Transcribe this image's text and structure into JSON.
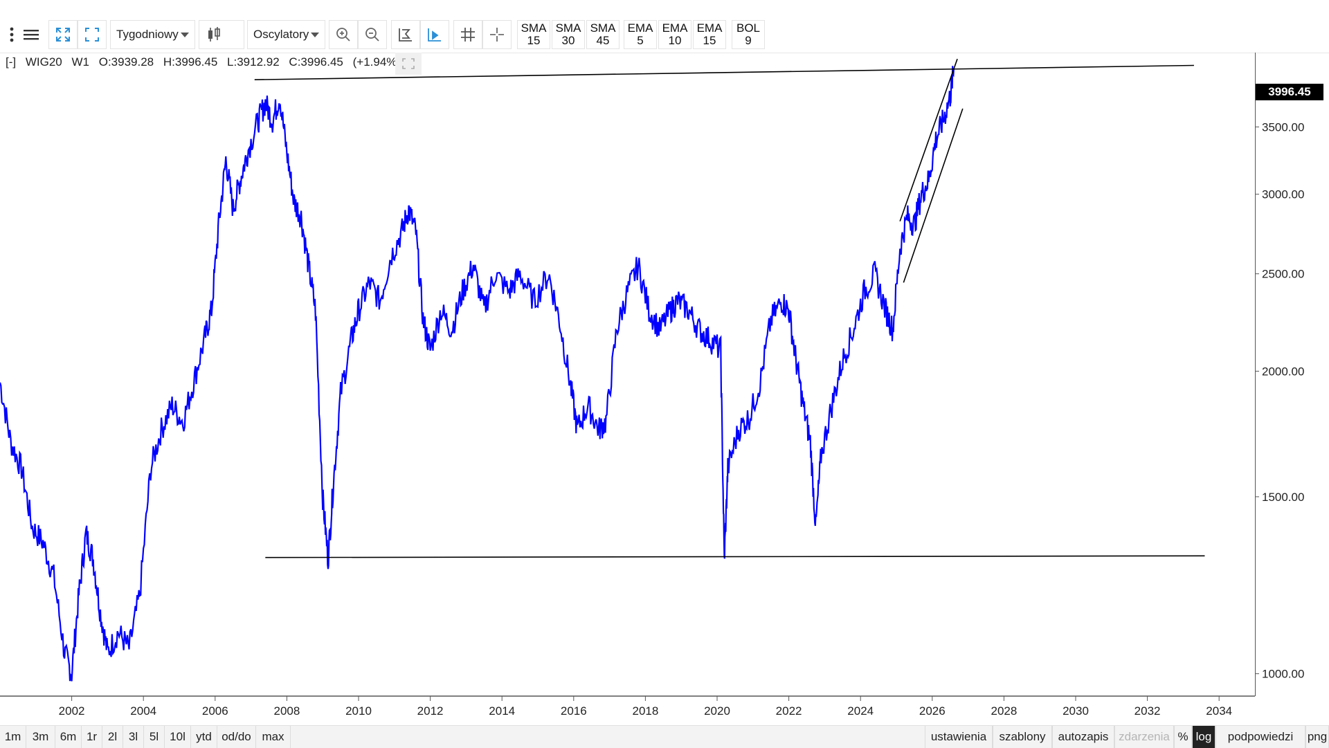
{
  "toolbar": {
    "period_label": "Tygodniowy",
    "oscillators_label": "Oscylatory",
    "indicators": [
      {
        "name": "SMA",
        "value": "15"
      },
      {
        "name": "SMA",
        "value": "30"
      },
      {
        "name": "SMA",
        "value": "45"
      },
      {
        "name": "EMA",
        "value": "5"
      },
      {
        "name": "EMA",
        "value": "10"
      },
      {
        "name": "EMA",
        "value": "15"
      },
      {
        "name": "BOL",
        "value": "9"
      }
    ]
  },
  "info": {
    "collapse": "[-]",
    "symbol": "WIG20",
    "interval": "W1",
    "open": "O:3939.28",
    "high": "H:3996.45",
    "low": "L:3912.92",
    "close": "C:3996.45",
    "change": "(+1.94%)"
  },
  "last_price_label": "3996.45",
  "colors": {
    "series": "#0000ff",
    "trendline": "#000000",
    "axis": "#555555"
  },
  "chart_data": {
    "type": "line",
    "scale": "log",
    "grid": false,
    "x_ticks": [
      "2002",
      "2004",
      "2006",
      "2008",
      "2010",
      "2012",
      "2014",
      "2016",
      "2018",
      "2020",
      "2022",
      "2024",
      "2026",
      "2028",
      "2030",
      "2032",
      "2034"
    ],
    "y_ticks": [
      1000,
      1500,
      2000,
      2500,
      3000,
      3500
    ],
    "y_tick_labels": [
      "1000.00",
      "1500.00",
      "2000.00",
      "2500.00",
      "3000.00",
      "3500.00"
    ],
    "xlim": [
      2000.0,
      2035.0
    ],
    "ylim": [
      950,
      4150
    ],
    "series_points": [
      [
        2000.0,
        1950
      ],
      [
        2000.3,
        1700
      ],
      [
        2000.6,
        1600
      ],
      [
        2000.9,
        1400
      ],
      [
        2001.2,
        1350
      ],
      [
        2001.5,
        1250
      ],
      [
        2001.8,
        1050
      ],
      [
        2002.0,
        1000
      ],
      [
        2002.2,
        1200
      ],
      [
        2002.4,
        1380
      ],
      [
        2002.6,
        1300
      ],
      [
        2002.8,
        1150
      ],
      [
        2003.0,
        1050
      ],
      [
        2003.3,
        1100
      ],
      [
        2003.6,
        1060
      ],
      [
        2003.9,
        1200
      ],
      [
        2004.2,
        1600
      ],
      [
        2004.5,
        1750
      ],
      [
        2004.8,
        1850
      ],
      [
        2005.1,
        1780
      ],
      [
        2005.4,
        1950
      ],
      [
        2005.7,
        2150
      ],
      [
        2005.9,
        2300
      ],
      [
        2006.1,
        2800
      ],
      [
        2006.3,
        3250
      ],
      [
        2006.5,
        2900
      ],
      [
        2006.7,
        3100
      ],
      [
        2006.9,
        3300
      ],
      [
        2007.2,
        3550
      ],
      [
        2007.4,
        3700
      ],
      [
        2007.6,
        3550
      ],
      [
        2007.8,
        3750
      ],
      [
        2008.0,
        3300
      ],
      [
        2008.2,
        2950
      ],
      [
        2008.4,
        2850
      ],
      [
        2008.6,
        2550
      ],
      [
        2008.8,
        2300
      ],
      [
        2009.0,
        1500
      ],
      [
        2009.15,
        1300
      ],
      [
        2009.3,
        1550
      ],
      [
        2009.5,
        1900
      ],
      [
        2009.8,
        2150
      ],
      [
        2010.0,
        2300
      ],
      [
        2010.3,
        2450
      ],
      [
        2010.6,
        2350
      ],
      [
        2010.9,
        2600
      ],
      [
        2011.2,
        2750
      ],
      [
        2011.4,
        2900
      ],
      [
        2011.6,
        2750
      ],
      [
        2011.8,
        2250
      ],
      [
        2012.0,
        2100
      ],
      [
        2012.3,
        2300
      ],
      [
        2012.6,
        2200
      ],
      [
        2012.9,
        2400
      ],
      [
        2013.2,
        2550
      ],
      [
        2013.5,
        2300
      ],
      [
        2013.8,
        2500
      ],
      [
        2014.2,
        2400
      ],
      [
        2014.5,
        2500
      ],
      [
        2014.9,
        2350
      ],
      [
        2015.3,
        2500
      ],
      [
        2015.6,
        2250
      ],
      [
        2015.9,
        1950
      ],
      [
        2016.1,
        1750
      ],
      [
        2016.4,
        1850
      ],
      [
        2016.7,
        1750
      ],
      [
        2016.9,
        1780
      ],
      [
        2017.2,
        2200
      ],
      [
        2017.5,
        2400
      ],
      [
        2017.8,
        2550
      ],
      [
        2018.1,
        2300
      ],
      [
        2018.4,
        2200
      ],
      [
        2018.7,
        2300
      ],
      [
        2018.9,
        2350
      ],
      [
        2019.2,
        2300
      ],
      [
        2019.5,
        2200
      ],
      [
        2019.8,
        2150
      ],
      [
        2020.1,
        2100
      ],
      [
        2020.2,
        1300
      ],
      [
        2020.3,
        1600
      ],
      [
        2020.6,
        1750
      ],
      [
        2020.9,
        1800
      ],
      [
        2021.2,
        1950
      ],
      [
        2021.5,
        2250
      ],
      [
        2021.8,
        2350
      ],
      [
        2022.0,
        2300
      ],
      [
        2022.2,
        2050
      ],
      [
        2022.4,
        1850
      ],
      [
        2022.6,
        1700
      ],
      [
        2022.75,
        1400
      ],
      [
        2022.9,
        1650
      ],
      [
        2023.2,
        1850
      ],
      [
        2023.5,
        2050
      ],
      [
        2023.8,
        2200
      ],
      [
        2024.1,
        2400
      ],
      [
        2024.4,
        2500
      ],
      [
        2024.7,
        2300
      ],
      [
        2024.9,
        2200
      ],
      [
        2025.1,
        2650
      ],
      [
        2025.3,
        2850
      ],
      [
        2025.5,
        2800
      ],
      [
        2025.7,
        3000
      ],
      [
        2025.9,
        3100
      ],
      [
        2026.1,
        3400
      ],
      [
        2026.3,
        3550
      ],
      [
        2026.5,
        3750
      ],
      [
        2026.6,
        3996
      ]
    ],
    "trendlines": [
      {
        "x": [
          2007.1,
          2033.3
        ],
        "y": [
          3900,
          4030
        ]
      },
      {
        "x": [
          2007.4,
          2033.6
        ],
        "y": [
          1305,
          1310
        ]
      },
      {
        "x": [
          2025.1,
          2026.7
        ],
        "y": [
          2820,
          4090
        ]
      },
      {
        "x": [
          2025.2,
          2026.85
        ],
        "y": [
          2450,
          3650
        ]
      }
    ]
  },
  "bottom": {
    "left": [
      "1m",
      "3m",
      "6m",
      "1r",
      "2l",
      "3l",
      "5l",
      "10l",
      "ytd",
      "od/do",
      "max"
    ],
    "right": [
      "ustawienia",
      "szablony",
      "autozapis",
      "zdarzenia",
      "%",
      "log",
      "podpowiedzi",
      "png"
    ]
  }
}
